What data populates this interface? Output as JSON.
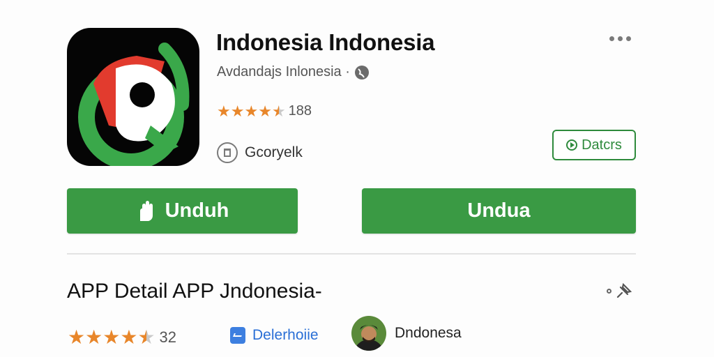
{
  "app": {
    "title": "Indonesia Indonesia",
    "subtitle": "Avdandajs Inlonesia ·",
    "rating_text": "188",
    "rating_stars": 4.5,
    "developer": "Gcoryelk",
    "details_label": "Datcrs"
  },
  "actions": {
    "install_primary_label": "Unduh",
    "install_secondary_label": "Undua"
  },
  "section": {
    "title": "APP Detail APP Jndonesia-"
  },
  "bottom": {
    "rating_count": "32",
    "rating_stars": 4.5,
    "category_label": "Delerhoiie",
    "publisher_name": "Dndonesa"
  },
  "colors": {
    "accent_green": "#3a9a44",
    "star_orange": "#e8862a",
    "link_blue": "#2a6fd6"
  },
  "icons": {
    "more": "more-horizontal-icon",
    "globe": "globe-icon",
    "developer": "developer-badge-icon",
    "details": "play-circle-icon",
    "install": "hand-download-icon",
    "category": "category-icon",
    "section_action": "pin-icon"
  }
}
